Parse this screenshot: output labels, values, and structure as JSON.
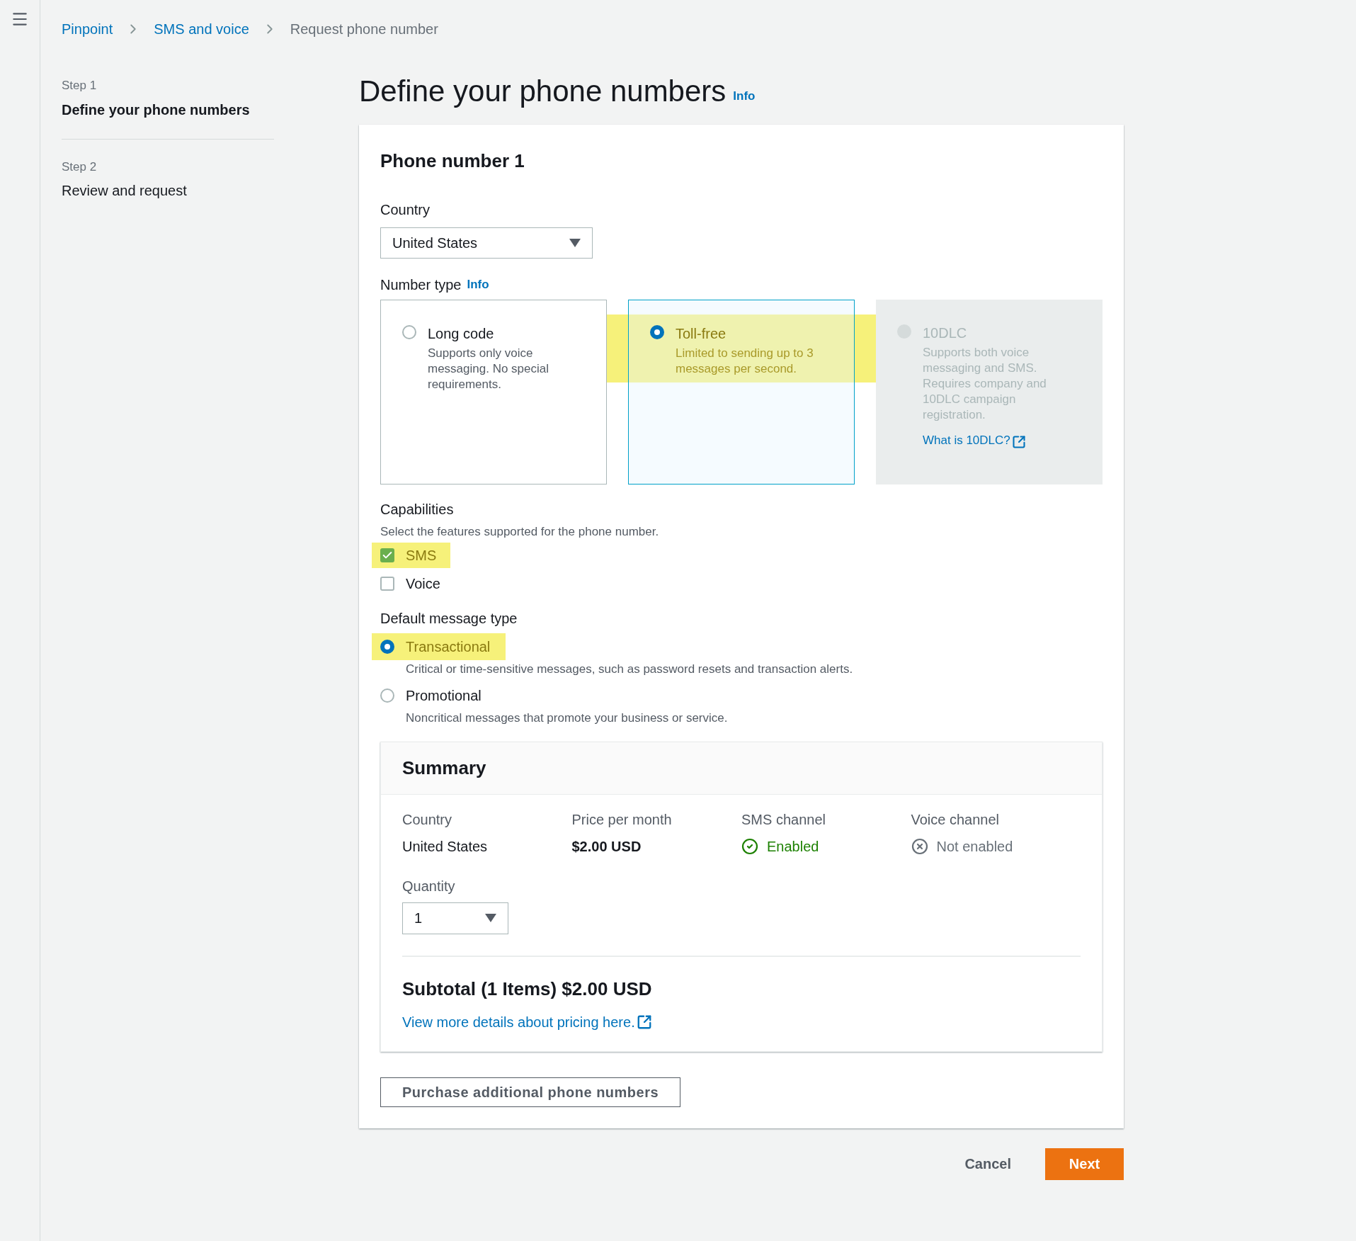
{
  "breadcrumbs": [
    {
      "label": "Pinpoint",
      "kind": "link"
    },
    {
      "label": "SMS and voice",
      "kind": "link"
    },
    {
      "label": "Request phone number",
      "kind": "current"
    }
  ],
  "steps": [
    {
      "step": "Step 1",
      "title": "Define your phone numbers",
      "selected": true
    },
    {
      "step": "Step 2",
      "title": "Review and request",
      "selected": false
    }
  ],
  "page_title": "Define your phone numbers",
  "page_info": "Info",
  "phone_number": {
    "heading": "Phone number 1",
    "country_label": "Country",
    "country_value": "United States",
    "number_type_label": "Number type",
    "number_type_info": "Info",
    "number_types": [
      {
        "label": "Long code",
        "description": "Supports only voice messaging. No special requirements.",
        "selected": false,
        "disabled": false,
        "highlighted": false
      },
      {
        "label": "Toll-free",
        "description": "Limited to sending up to 3 messages per second.",
        "selected": true,
        "disabled": false,
        "highlighted": true
      },
      {
        "label": "10DLC",
        "description": "Supports both voice messaging and SMS. Requires company and 10DLC campaign registration.",
        "link": "What is 10DLC?",
        "selected": false,
        "disabled": true,
        "highlighted": false
      }
    ],
    "capabilities_label": "Capabilities",
    "capabilities_hint": "Select the features supported for the phone number.",
    "capabilities": [
      {
        "label": "SMS",
        "checked": true,
        "highlighted": true
      },
      {
        "label": "Voice",
        "checked": false,
        "highlighted": false
      }
    ],
    "message_type_label": "Default message type",
    "message_types": [
      {
        "label": "Transactional",
        "description": "Critical or time-sensitive messages, such as password resets and transaction alerts.",
        "selected": true,
        "highlighted": true
      },
      {
        "label": "Promotional",
        "description": "Noncritical messages that promote your business or service.",
        "selected": false,
        "highlighted": false
      }
    ],
    "summary": {
      "heading": "Summary",
      "fields": [
        {
          "label": "Country",
          "value": "United States",
          "kind": "text"
        },
        {
          "label": "Price per month",
          "value": "$2.00 USD",
          "kind": "bold"
        },
        {
          "label": "SMS channel",
          "value": "Enabled",
          "kind": "status",
          "on": true
        },
        {
          "label": "Voice channel",
          "value": "Not enabled",
          "kind": "status",
          "on": false
        }
      ],
      "quantity_label": "Quantity",
      "quantity_value": "1",
      "subtotal": "Subtotal (1 Items) $2.00 USD",
      "pricing_link": "View more details about pricing here."
    },
    "purchase_button": "Purchase additional phone numbers"
  },
  "actions": {
    "cancel": "Cancel",
    "next": "Next"
  }
}
